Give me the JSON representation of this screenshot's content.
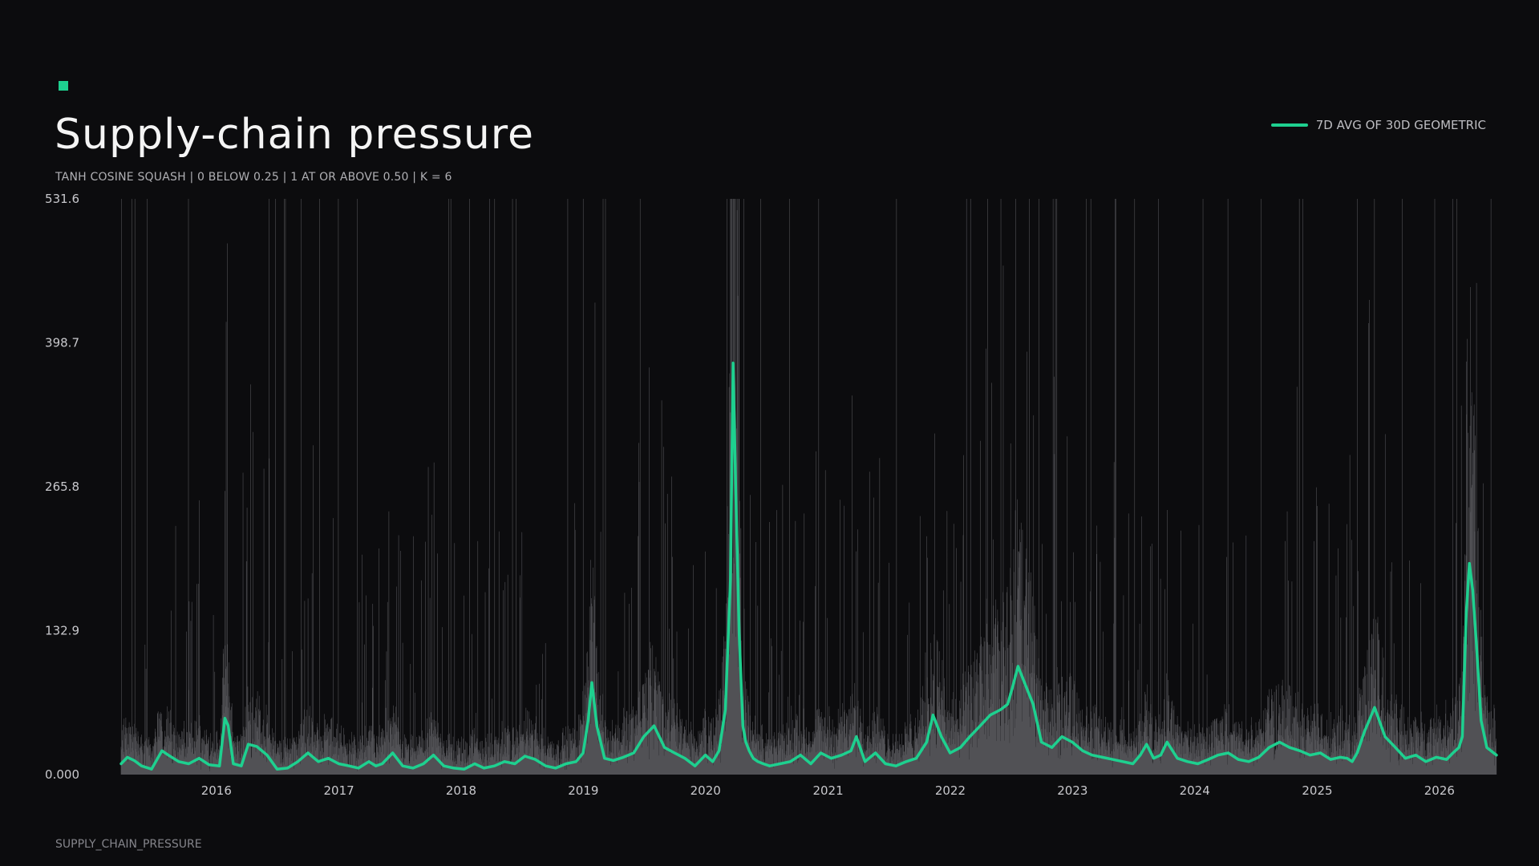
{
  "title": "Supply-chain pressure",
  "subtitle": "TANH COSINE SQUASH | 0 BELOW 0.25 | 1 AT OR ABOVE 0.50 | K = 6",
  "footer": "SUPPLY_CHAIN_PRESSURE",
  "colors": {
    "background": "#0c0c0e",
    "accent": "#1ed08f",
    "raw_bars": "#8a8a90"
  },
  "chart_data": {
    "type": "line",
    "legend_position": "top-right",
    "grid": false,
    "x_range": [
      "2015-04-01",
      "2026-06-30"
    ],
    "ylim": [
      0,
      531.6
    ],
    "y_ticks": [
      "0.000",
      "132.9",
      "265.8",
      "398.7",
      "531.6"
    ],
    "x_ticks": [
      "2016",
      "2017",
      "2018",
      "2019",
      "2020",
      "2021",
      "2022",
      "2023",
      "2024",
      "2025",
      "2026"
    ],
    "series": [
      {
        "name": "7D AVG OF 30D GEOMETRIC",
        "x": [
          "2015-04-01",
          "2015-04-20",
          "2015-05-10",
          "2015-06-01",
          "2015-07-01",
          "2015-08-01",
          "2015-08-20",
          "2015-09-20",
          "2015-10-20",
          "2015-11-20",
          "2015-12-20",
          "2016-01-20",
          "2016-02-05",
          "2016-02-15",
          "2016-03-01",
          "2016-03-25",
          "2016-04-15",
          "2016-05-10",
          "2016-06-10",
          "2016-07-10",
          "2016-08-10",
          "2016-09-10",
          "2016-10-10",
          "2016-11-10",
          "2016-12-10",
          "2017-01-10",
          "2017-02-10",
          "2017-03-10",
          "2017-04-10",
          "2017-05-01",
          "2017-05-20",
          "2017-06-20",
          "2017-07-20",
          "2017-08-20",
          "2017-09-20",
          "2017-10-20",
          "2017-11-20",
          "2017-12-20",
          "2018-01-20",
          "2018-02-20",
          "2018-03-20",
          "2018-04-20",
          "2018-05-20",
          "2018-06-20",
          "2018-07-20",
          "2018-08-20",
          "2018-09-20",
          "2018-10-20",
          "2018-11-20",
          "2018-12-20",
          "2019-01-10",
          "2019-01-25",
          "2019-02-05",
          "2019-02-20",
          "2019-03-15",
          "2019-04-10",
          "2019-05-10",
          "2019-06-10",
          "2019-07-10",
          "2019-08-10",
          "2019-09-10",
          "2019-10-10",
          "2019-11-10",
          "2019-12-10",
          "2020-01-10",
          "2020-02-01",
          "2020-02-20",
          "2020-03-10",
          "2020-03-25",
          "2020-04-02",
          "2020-04-10",
          "2020-04-20",
          "2020-05-01",
          "2020-05-10",
          "2020-05-20",
          "2020-06-01",
          "2020-06-15",
          "2020-07-01",
          "2020-07-20",
          "2020-08-20",
          "2020-09-20",
          "2020-10-20",
          "2020-11-20",
          "2020-12-20",
          "2021-01-20",
          "2021-02-20",
          "2021-03-20",
          "2021-04-05",
          "2021-05-01",
          "2021-06-01",
          "2021-07-01",
          "2021-08-01",
          "2021-09-01",
          "2021-10-01",
          "2021-11-01",
          "2021-11-20",
          "2021-12-15",
          "2022-01-10",
          "2022-02-10",
          "2022-03-10",
          "2022-04-10",
          "2022-05-10",
          "2022-06-10",
          "2022-07-01",
          "2022-07-15",
          "2022-08-01",
          "2022-08-20",
          "2022-09-15",
          "2022-10-10",
          "2022-11-10",
          "2022-12-10",
          "2023-01-10",
          "2023-02-10",
          "2023-03-10",
          "2023-04-10",
          "2023-05-10",
          "2023-06-10",
          "2023-07-10",
          "2023-08-01",
          "2023-08-20",
          "2023-09-10",
          "2023-10-01",
          "2023-10-20",
          "2023-11-20",
          "2023-12-20",
          "2024-01-20",
          "2024-02-20",
          "2024-03-20",
          "2024-04-20",
          "2024-05-20",
          "2024-06-20",
          "2024-07-20",
          "2024-08-20",
          "2024-09-20",
          "2024-10-20",
          "2024-11-20",
          "2024-12-20",
          "2025-01-20",
          "2025-02-20",
          "2025-03-20",
          "2025-04-10",
          "2025-04-25",
          "2025-05-10",
          "2025-06-01",
          "2025-07-01",
          "2025-08-01",
          "2025-09-01",
          "2025-10-01",
          "2025-11-01",
          "2025-12-01",
          "2026-01-01",
          "2026-02-01",
          "2026-02-20",
          "2026-03-10",
          "2026-03-20",
          "2026-04-01",
          "2026-04-10",
          "2026-04-20",
          "2026-05-01",
          "2026-05-15",
          "2026-06-01",
          "2026-06-30"
        ],
        "values": [
          10,
          16,
          13,
          8,
          5,
          22,
          18,
          12,
          10,
          15,
          9,
          8,
          52,
          45,
          10,
          8,
          28,
          26,
          18,
          5,
          6,
          12,
          20,
          12,
          15,
          10,
          8,
          6,
          12,
          8,
          10,
          20,
          8,
          6,
          10,
          18,
          8,
          6,
          5,
          10,
          6,
          8,
          12,
          10,
          17,
          14,
          8,
          6,
          10,
          12,
          20,
          50,
          85,
          45,
          15,
          13,
          16,
          20,
          35,
          45,
          25,
          20,
          15,
          8,
          18,
          12,
          22,
          60,
          180,
          380,
          260,
          130,
          45,
          30,
          22,
          15,
          12,
          10,
          8,
          10,
          12,
          18,
          10,
          20,
          15,
          18,
          22,
          35,
          12,
          20,
          10,
          8,
          12,
          15,
          30,
          55,
          35,
          20,
          25,
          35,
          45,
          55,
          60,
          65,
          80,
          100,
          85,
          65,
          30,
          25,
          35,
          30,
          22,
          18,
          16,
          14,
          12,
          10,
          18,
          28,
          15,
          18,
          30,
          15,
          12,
          10,
          14,
          18,
          20,
          14,
          12,
          16,
          25,
          30,
          25,
          22,
          18,
          20,
          14,
          16,
          15,
          12,
          20,
          40,
          62,
          35,
          25,
          15,
          18,
          12,
          16,
          14,
          20,
          25,
          35,
          150,
          195,
          170,
          120,
          50,
          25,
          18
        ]
      }
    ]
  }
}
